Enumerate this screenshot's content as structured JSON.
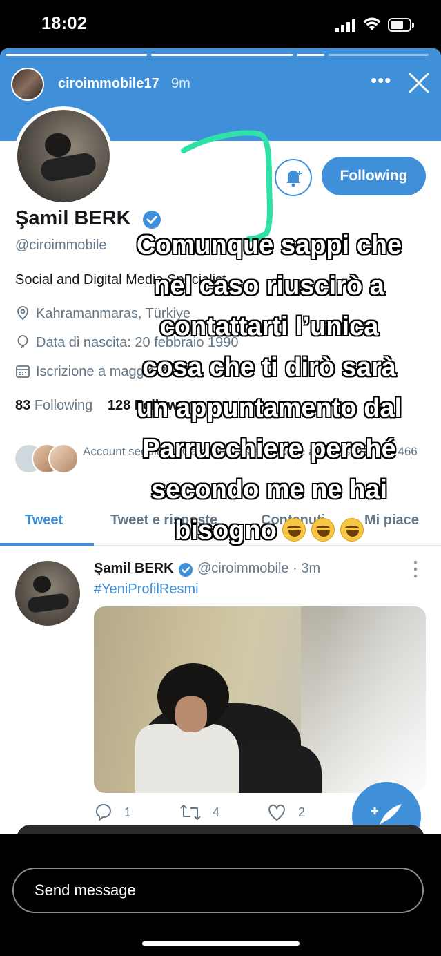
{
  "status_bar": {
    "time": "18:02",
    "battery_level": 0.7
  },
  "story": {
    "username": "ciroimmobile17",
    "posted_ago": "9m",
    "progress": [
      1,
      1,
      1,
      0
    ]
  },
  "profile": {
    "name": "Şamil BERK",
    "handle": "@ciroimmobile",
    "bio": "Social and Digital Media Specialist",
    "location": "Kahramanmaras, Türkiye",
    "birth": "Data di nascita: 20 febbraio 1990",
    "joined": "Iscrizione a maggio 2012",
    "following_count": "83",
    "following_label": "Following",
    "followers_text": "128 Follower",
    "followed_by": "Account seguiti da Carolina Castelli, ecc. e altri Fusco e altri 466",
    "follow_button": "Following",
    "accent": "#3f8fd9"
  },
  "tabs": [
    "Tweet",
    "Tweet e risposte",
    "Contenuti",
    "Mi piace"
  ],
  "tweet": {
    "name": "Şamil BERK",
    "handle_time": "@ciroimmobile · 3m",
    "text": "#YeniProfilResmi",
    "replies": "1",
    "retweets": "4",
    "likes": "2"
  },
  "caption": {
    "lines": [
      "Comunque sappi che",
      "nel caso riuscirò a",
      "contattarti l’unica",
      "cosa che ti dirò sarà",
      "un appuntamento dal",
      "Parrucchiere perché",
      "secondo me ne hai",
      "bisogno"
    ],
    "emoji": "face-with-tears-of-joy",
    "emoji_count": 3
  },
  "doodle_color": "#2fe0a8",
  "send": {
    "placeholder": "Send message"
  }
}
